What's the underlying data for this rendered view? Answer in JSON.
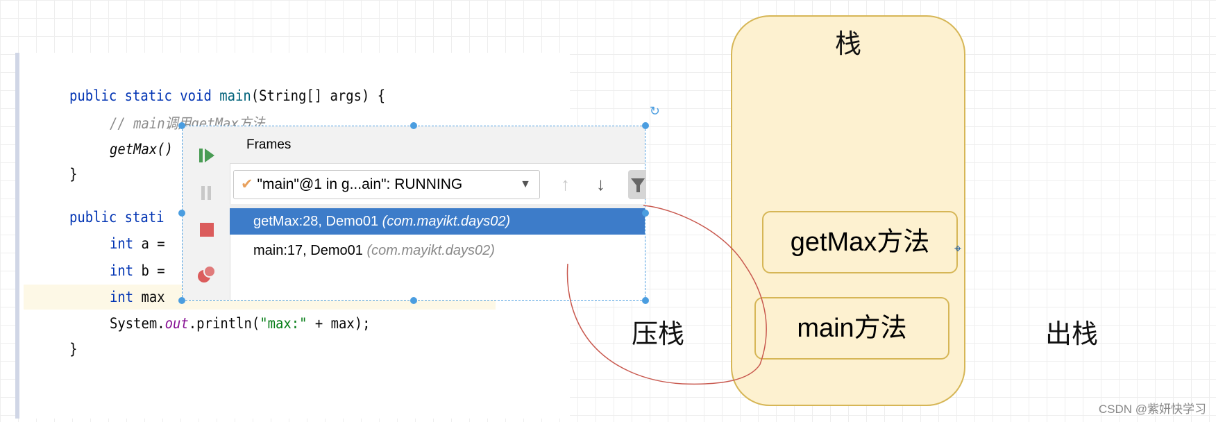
{
  "code": {
    "l1": [
      "public static void ",
      "main",
      "(String[] args) {"
    ],
    "l2": "// main调用getMax方法",
    "l3": "getMax()",
    "l4": "}",
    "l5": "public stati",
    "l6": [
      "int",
      " a ="
    ],
    "l7": [
      "int",
      " b ="
    ],
    "l8": [
      "int",
      " max"
    ],
    "l9": [
      "System.",
      "out",
      ".println(",
      "\"max:\"",
      " + max);"
    ],
    "l10": "}"
  },
  "frames_popup": {
    "title": "Frames",
    "thread_select": "\"main\"@1 in g...ain\": RUNNING",
    "frames": [
      {
        "method": "getMax:28, Demo01",
        "package": "(com.mayikt.days02)",
        "selected": true
      },
      {
        "method": "main:17, Demo01",
        "package": "(com.mayikt.days02)",
        "selected": false
      }
    ]
  },
  "diagram": {
    "stack_label": "栈",
    "frames": [
      "getMax方法",
      "main方法"
    ],
    "push_label": "压栈",
    "pop_label": "出栈",
    "fill": "#fdf1d0",
    "stroke": "#d6b656"
  },
  "watermark": "CSDN @紫妍快学习"
}
